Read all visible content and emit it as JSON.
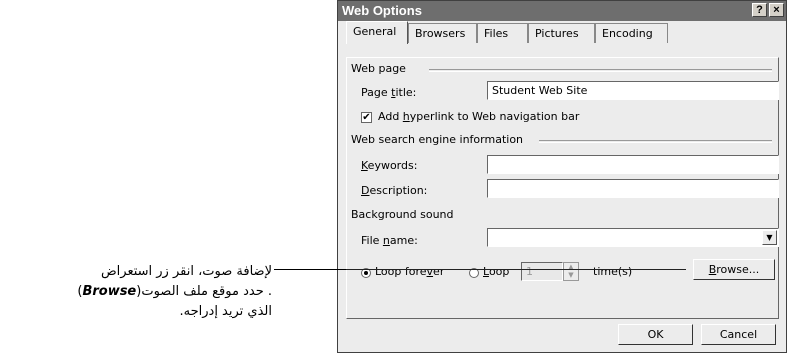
{
  "dialog": {
    "title": "Web Options",
    "help_button": "?",
    "close_button": "×"
  },
  "tabs": [
    {
      "label": "General"
    },
    {
      "label": "Browsers"
    },
    {
      "label": "Files"
    },
    {
      "label": "Pictures"
    },
    {
      "label": "Encoding"
    }
  ],
  "web_page": {
    "group_label": "Web page",
    "page_title_label": "Page title:",
    "page_title_value": "Student Web Site",
    "hyperlink_checkbox_label": "Add hyperlink to Web navigation bar",
    "hyperlink_checked": true
  },
  "search_engine": {
    "group_label": "Web search engine information",
    "keywords_label": "Keywords:",
    "keywords_value": "",
    "description_label": "Description:",
    "description_value": ""
  },
  "background_sound": {
    "group_label": "Background sound",
    "file_name_label": "File name:",
    "file_name_value": "",
    "loop_forever_label": "Loop forever",
    "loop_label": "Loop",
    "loop_count": "1",
    "times_label": "time(s)",
    "browse_button": "Browse..."
  },
  "footer": {
    "ok_button": "OK",
    "cancel_button": "Cancel"
  },
  "callout": {
    "line1": "لإضافة صوت، انقر زر استعراض",
    "browse_word": "Browse",
    "line2_rest": ". حدد موقع ملف الصوت",
    "line3": "الذي تريد إدراجه."
  }
}
